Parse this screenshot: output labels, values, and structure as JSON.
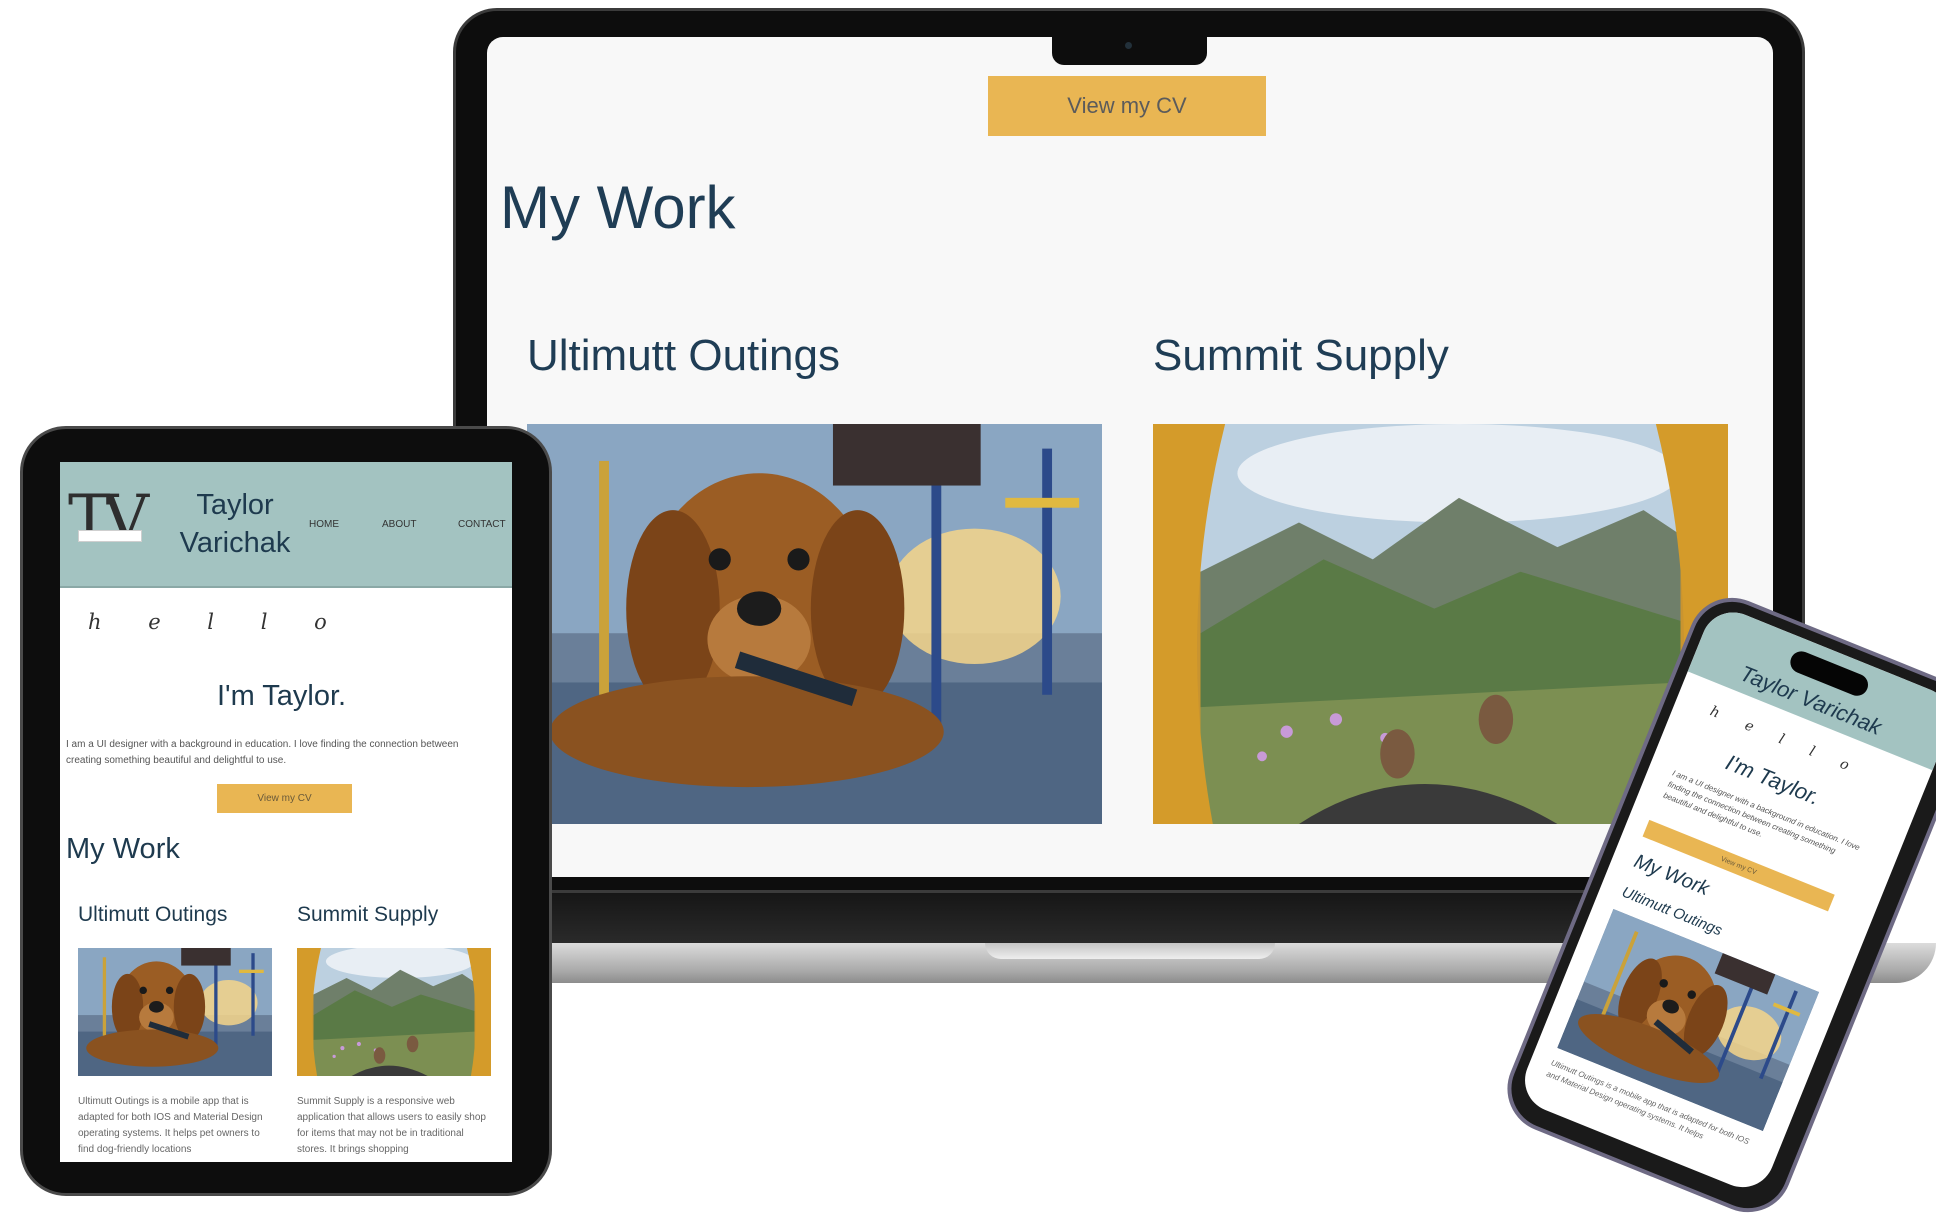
{
  "laptop": {
    "cv_button": "View my CV",
    "section_title": "My Work",
    "projects": [
      {
        "title": "Ultimutt Outings",
        "image": "golden-retriever-puppy-photo"
      },
      {
        "title": "Summit Supply",
        "image": "mountain-tent-view-photo"
      }
    ]
  },
  "tablet": {
    "logo": "TV",
    "name_line1": "Taylor",
    "name_line2": "Varichak",
    "nav": [
      "HOME",
      "ABOUT",
      "CONTACT"
    ],
    "hello": "h e l l o",
    "heading": "I'm Taylor.",
    "intro": "I am a UI designer with a background in education. I love finding the connection between creating something beautiful and delightful to use.",
    "cv_button": "View my CV",
    "section_title": "My Work",
    "projects": [
      {
        "title": "Ultimutt Outings",
        "desc": "Ultimutt Outings is a mobile app that is adapted for both IOS and Material Design operating systems. It helps pet owners to find dog-friendly locations"
      },
      {
        "title": "Summit Supply",
        "desc": "Summit Supply is a responsive web application that allows users to easily shop for items that may not be in traditional stores. It brings shopping"
      }
    ]
  },
  "phone": {
    "name": "Taylor Varichak",
    "hello": "h e l l o",
    "heading": "I'm Taylor.",
    "intro": "I am a UI designer with a background in education. I love finding the connection between creating something beautiful and delightful to use.",
    "cv_button": "View my CV",
    "section_title": "My Work",
    "project_title": "Ultimutt Outings",
    "project_desc": "Ultimutt Outings is a mobile app that is adapted for both IOS and Material Design operating systems. It helps"
  },
  "colors": {
    "accent": "#e9b653",
    "header_bg": "#a3c3c1",
    "heading_text": "#1f3d55"
  }
}
